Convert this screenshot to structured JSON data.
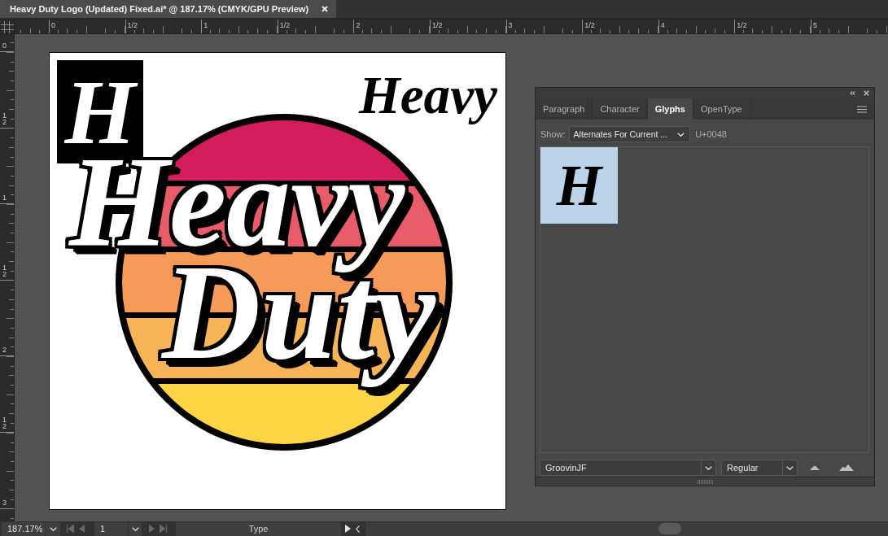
{
  "document_tab": {
    "title": "Heavy Duty Logo (Updated) Fixed.ai* @ 187.17% (CMYK/GPU Preview)"
  },
  "rulers": {
    "top_labels": [
      "0",
      "1/2",
      "1",
      "1/2",
      "2",
      "1/2",
      "3",
      "1/2",
      "4",
      "1/2",
      "5"
    ],
    "left_labels": [
      "0",
      "12",
      "1",
      "12",
      "2",
      "12",
      "3"
    ]
  },
  "artboard": {
    "monogram": "H",
    "wordmark": "Heavy",
    "emblem": {
      "stripes": [
        {
          "color": "#d31c5b"
        },
        {
          "color": "#e85b68"
        },
        {
          "color": "#f59a58"
        },
        {
          "color": "#f7b456"
        },
        {
          "color": "#fdd444"
        }
      ],
      "lines": [
        "Heavy",
        "Duty"
      ]
    }
  },
  "glyphs_panel": {
    "tabs": [
      {
        "label": "Paragraph",
        "selected": false
      },
      {
        "label": "Character",
        "selected": false
      },
      {
        "label": "Glyphs",
        "selected": true
      },
      {
        "label": "OpenType",
        "selected": false
      }
    ],
    "show": {
      "label": "Show:",
      "value": "Alternates For Current ...",
      "code": "U+0048"
    },
    "glyphs": [
      {
        "char": "H",
        "selected": true
      }
    ],
    "font_family": "GroovinJF",
    "font_style": "Regular"
  },
  "status_bar": {
    "zoom": "187.17%",
    "page_nav_back": [
      {
        "kind": "first",
        "disabled": true
      },
      {
        "kind": "previous",
        "disabled": true
      }
    ],
    "page": "1",
    "page_nav_forward": [
      {
        "kind": "next",
        "disabled": true
      },
      {
        "kind": "last",
        "disabled": true
      }
    ],
    "tool": "Type"
  }
}
